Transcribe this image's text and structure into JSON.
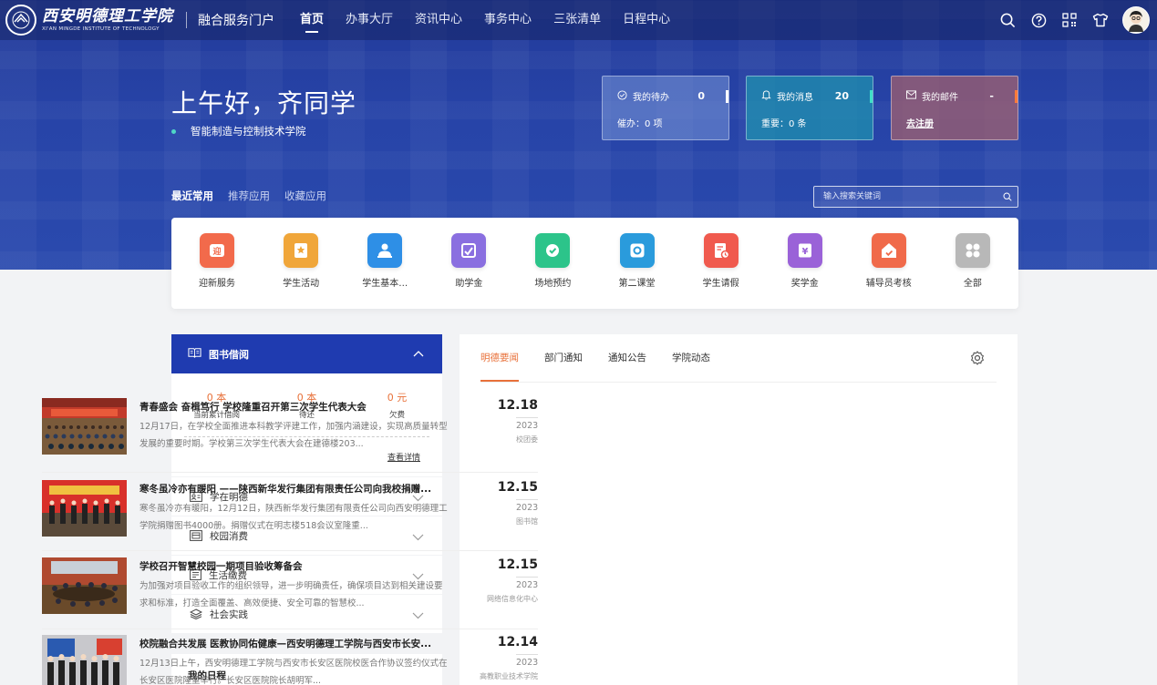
{
  "nav": {
    "logo_cn": "西安明德理工学院",
    "logo_en": "XI'AN MINGDE INSTITUTE OF TECHNOLOGY",
    "portal_name": "融合服务门户",
    "menu": [
      "首页",
      "办事大厅",
      "资讯中心",
      "事务中心",
      "三张清单",
      "日程中心"
    ],
    "active_index": 0,
    "icons": [
      "search-icon",
      "help-icon",
      "qrcode-icon",
      "skin-icon"
    ]
  },
  "greeting": {
    "text": "上午好，齐同学",
    "college": "智能制造与控制技术学院"
  },
  "stats": {
    "todo": {
      "label": "我的待办",
      "value": "0",
      "sub": "催办：0 项"
    },
    "msg": {
      "label": "我的消息",
      "value": "20",
      "sub": "重要：0 条"
    },
    "mail": {
      "label": "我的邮件",
      "value": "-",
      "sub": "去注册"
    }
  },
  "app_tabs": [
    "最近常用",
    "推荐应用",
    "收藏应用"
  ],
  "search": {
    "placeholder": "输入搜索关键词"
  },
  "apps": [
    {
      "label": "迎新服务",
      "color": "#f26a4b",
      "icon": "welcome-icon"
    },
    {
      "label": "学生活动",
      "color": "#f0a63a",
      "icon": "activity-icon"
    },
    {
      "label": "学生基本…",
      "color": "#2e8fe6",
      "icon": "student-info-icon"
    },
    {
      "label": "助学金",
      "color": "#8a6fe0",
      "icon": "grant-icon"
    },
    {
      "label": "场地预约",
      "color": "#2cc48a",
      "icon": "venue-icon"
    },
    {
      "label": "第二课堂",
      "color": "#2a9bdc",
      "icon": "second-class-icon"
    },
    {
      "label": "学生请假",
      "color": "#f05a4e",
      "icon": "leave-icon"
    },
    {
      "label": "奖学金",
      "color": "#9a62d8",
      "icon": "scholarship-icon"
    },
    {
      "label": "辅导员考核",
      "color": "#f06a4a",
      "icon": "counselor-icon"
    },
    {
      "label": "全部",
      "color": "#b8b8b8",
      "icon": "all-apps-icon"
    }
  ],
  "library": {
    "title": "图书借阅",
    "stats": [
      {
        "value": "0 本",
        "label": "当前累计借阅"
      },
      {
        "value": "0 本",
        "label": "待还"
      },
      {
        "value": "0 元",
        "label": "欠费"
      }
    ],
    "detail": "查看详情"
  },
  "accordion": [
    {
      "label": "学在明德",
      "icon": "idcard-icon"
    },
    {
      "label": "校园消费",
      "icon": "consume-icon"
    },
    {
      "label": "生活缴费",
      "icon": "bill-icon"
    },
    {
      "label": "社会实践",
      "icon": "layers-icon"
    }
  ],
  "schedule": {
    "title": "我的日程"
  },
  "news": {
    "tabs": [
      "明德要闻",
      "部门通知",
      "通知公告",
      "学院动态"
    ],
    "active_tab": 0,
    "items": [
      {
        "title": "青春盛会 奋楫笃行 学校隆重召开第三次学生代表大会",
        "summary": "12月17日，在学校全面推进本科教学评建工作，加强内涵建设，实现高质量转型发展的重要时期。学校第三次学生代表大会在建德楼203...",
        "day": "12.18",
        "year": "2023",
        "dept": "校团委"
      },
      {
        "title": "寒冬虽冷亦有暖阳 ——陕西新华发行集团有限责任公司向我校捐赠...",
        "summary": "寒冬虽冷亦有暖阳，12月12日，陕西新华发行集团有限责任公司向西安明德理工学院捐赠图书4000册。捐赠仪式在明志楼518会议室隆重...",
        "day": "12.15",
        "year": "2023",
        "dept": "图书馆"
      },
      {
        "title": "学校召开智慧校园一期项目验收筹备会",
        "summary": "为加强对项目验收工作的组织领导，进一步明确责任，确保项目达到相关建设要求和标准，打造全面覆盖、高效便捷、安全可靠的智慧校...",
        "day": "12.15",
        "year": "2023",
        "dept": "网络信息化中心"
      },
      {
        "title": "校院融合共发展 医教协同佑健康—西安明德理工学院与西安市长安...",
        "summary": "12月13日上午，西安明德理工学院与西安市长安区医院校医合作协议签约仪式在长安区医院隆重举行。长安区医院院长胡明军...",
        "day": "12.14",
        "year": "2023",
        "dept": "高教职业技术学院"
      }
    ]
  }
}
